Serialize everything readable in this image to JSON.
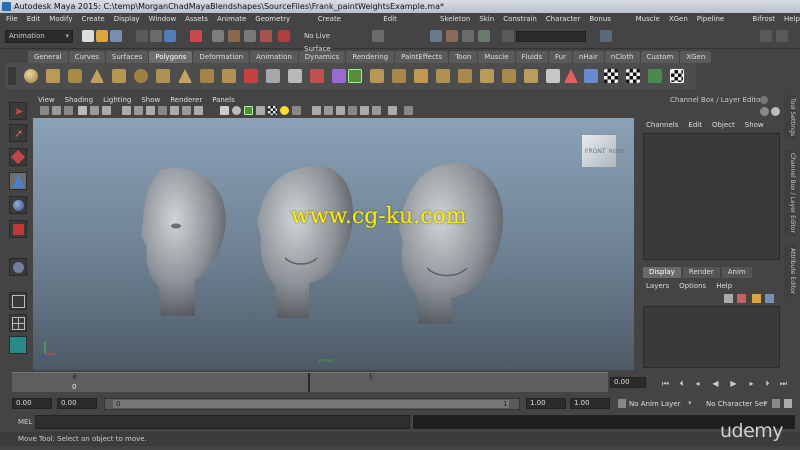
{
  "window": {
    "title": "Autodesk Maya 2015: C:\\temp\\MorganChadMayaBlendshapes\\SourceFiles\\Frank_paintWeightsExample.ma*"
  },
  "menubar": [
    "File",
    "Edit",
    "Modify",
    "Create",
    "Display",
    "Window",
    "Assets",
    "Animate",
    "Geometry Cache",
    "Create Deformers",
    "Edit Deformers",
    "Skeleton",
    "Skin",
    "Constrain",
    "Character",
    "Bonus Tools",
    "Muscle",
    "XGen",
    "Pipeline Cache",
    "Bifrost",
    "Help"
  ],
  "status": {
    "mode": "Animation",
    "live_surface": "No Live Surface"
  },
  "shelf": {
    "tabs": [
      "General",
      "Curves",
      "Surfaces",
      "Polygons",
      "Deformation",
      "Animation",
      "Dynamics",
      "Rendering",
      "PaintEffects",
      "Toon",
      "Muscle",
      "Fluids",
      "Fur",
      "nHair",
      "nCloth",
      "Custom",
      "XGen"
    ],
    "active_tab": "Polygons"
  },
  "panel": {
    "menu": [
      "View",
      "Shading",
      "Lighting",
      "Show",
      "Renderer",
      "Panels"
    ],
    "viewcube": {
      "front": "FRONT",
      "right": "RIGHT"
    },
    "watermark": "www.cg-ku.com",
    "camera": "persp"
  },
  "channel_box": {
    "header": "Channel Box / Layer Editor",
    "menu": [
      "Channels",
      "Edit",
      "Object",
      "Show"
    ]
  },
  "layer_editor": {
    "tabs": [
      "Display",
      "Render",
      "Anim"
    ],
    "active_tab": "Display",
    "menu": [
      "Layers",
      "Options",
      "Help"
    ]
  },
  "side_tabs": [
    "Tool Settings",
    "Channel Box / Layer Editor",
    "Attribute Editor"
  ],
  "timeline": {
    "start_label": "0",
    "tick_labels": [
      "0",
      "1"
    ],
    "current_frame": "0.00"
  },
  "range": {
    "start": "0.00",
    "inner_start": "0.00",
    "slider_start": "0",
    "slider_end": "1",
    "inner_end": "1.00",
    "end": "1.00",
    "anim_layer": "No Anim Layer",
    "character_set": "No Character Set"
  },
  "command_line": {
    "label": "MEL"
  },
  "help_line": "Move Tool: Select an object to move.",
  "branding": "udemy",
  "colors": {
    "viewport_top": "#8aa1b6",
    "viewport_bottom": "#4d5a66",
    "watermark": "#ffee00",
    "active_shelf_tab": "#6e6e6e"
  }
}
